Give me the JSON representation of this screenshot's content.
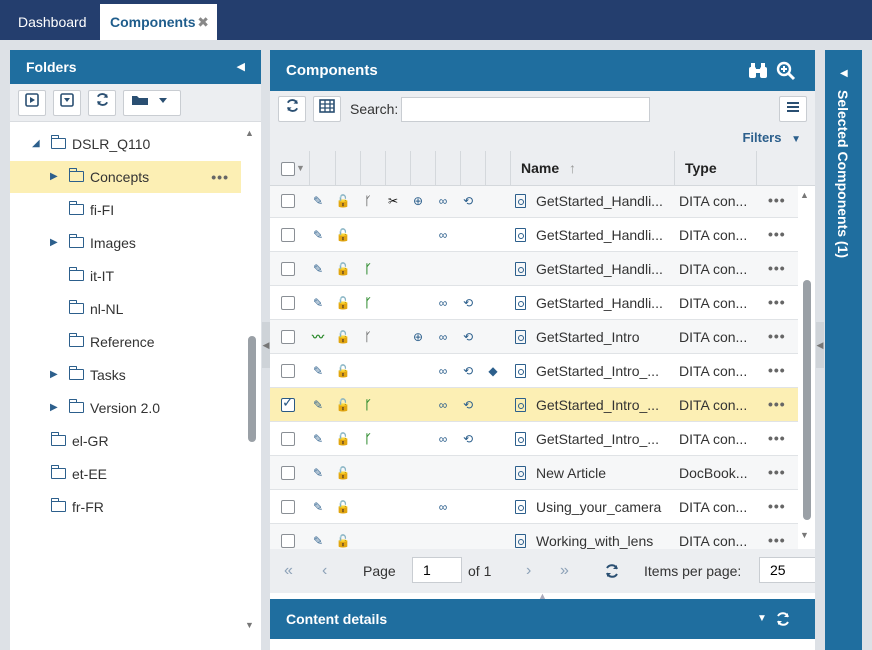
{
  "tabs": [
    {
      "label": "Dashboard"
    },
    {
      "label": "Components",
      "close": "✖"
    }
  ],
  "folders": {
    "title": "Folders",
    "items": [
      {
        "label": "DSLR_Q110",
        "expanded": true
      },
      {
        "label": "Concepts",
        "selected": true
      },
      {
        "label": "fi-FI"
      },
      {
        "label": "Images"
      },
      {
        "label": "it-IT"
      },
      {
        "label": "nl-NL"
      },
      {
        "label": "Reference"
      },
      {
        "label": "Tasks"
      },
      {
        "label": "Version 2.0"
      },
      {
        "label": "el-GR"
      },
      {
        "label": "et-EE"
      },
      {
        "label": "fr-FR"
      }
    ],
    "more": "•••"
  },
  "components": {
    "title": "Components",
    "search_label": "Search:",
    "search_value": "",
    "filters_label": "Filters",
    "columns": {
      "name": "Name",
      "type": "Type"
    },
    "rows": [
      {
        "name": "GetStarted_Handli...",
        "type": "DITA con...",
        "checked": false,
        "icons": [
          "edit",
          "unlock",
          "branch",
          "clip",
          "binoculars",
          "link",
          "sync"
        ]
      },
      {
        "name": "GetStarted_Handli...",
        "type": "DITA con...",
        "checked": false,
        "icons": [
          "edit",
          "unlock",
          "",
          "",
          "",
          "link",
          ""
        ]
      },
      {
        "name": "GetStarted_Handli...",
        "type": "DITA con...",
        "checked": false,
        "icons": [
          "edit",
          "unlock",
          "branch-green",
          "",
          "",
          "",
          ""
        ]
      },
      {
        "name": "GetStarted_Handli...",
        "type": "DITA con...",
        "checked": false,
        "icons": [
          "edit",
          "unlock",
          "branch-green",
          "",
          "",
          "link",
          "sync"
        ]
      },
      {
        "name": "GetStarted_Intro",
        "type": "DITA con...",
        "checked": false,
        "icons": [
          "wave",
          "unlock",
          "branch",
          "",
          "binoculars",
          "link",
          "sync"
        ]
      },
      {
        "name": "GetStarted_Intro_...",
        "type": "DITA con...",
        "checked": false,
        "icons": [
          "edit",
          "unlock",
          "",
          "",
          "",
          "link",
          "sync",
          "tag"
        ]
      },
      {
        "name": "GetStarted_Intro_...",
        "type": "DITA con...",
        "checked": true,
        "icons": [
          "edit",
          "unlock",
          "branch-green",
          "",
          "",
          "link",
          "sync"
        ]
      },
      {
        "name": "GetStarted_Intro_...",
        "type": "DITA con...",
        "checked": false,
        "icons": [
          "edit",
          "unlock",
          "branch-green",
          "",
          "",
          "link",
          "sync"
        ]
      },
      {
        "name": "New Article",
        "type": "DocBook...",
        "checked": false,
        "icons": [
          "edit",
          "unlock",
          "",
          "",
          "",
          "",
          ""
        ]
      },
      {
        "name": "Using_your_camera",
        "type": "DITA con...",
        "checked": false,
        "icons": [
          "edit",
          "unlock",
          "",
          "",
          "",
          "link",
          ""
        ]
      },
      {
        "name": "Working_with_lens",
        "type": "DITA con...",
        "checked": false,
        "icons": [
          "edit",
          "unlock",
          "",
          "",
          "",
          "",
          ""
        ]
      }
    ],
    "more": "•••"
  },
  "pager": {
    "page_label": "Page",
    "page_value": "1",
    "of_label": "of 1",
    "items_per_page_label": "Items per page:",
    "items_per_page_value": "25"
  },
  "content_details": {
    "title": "Content details"
  },
  "selected_panel": {
    "title": "Selected Components (1)"
  },
  "icons": {
    "edit": "✎",
    "unlock": "🔓",
    "branch": "ᚴ",
    "clip": "✂",
    "binoculars": "⊕",
    "link": "∞",
    "sync": "⟲",
    "tag": "◆",
    "wave": "〰"
  }
}
